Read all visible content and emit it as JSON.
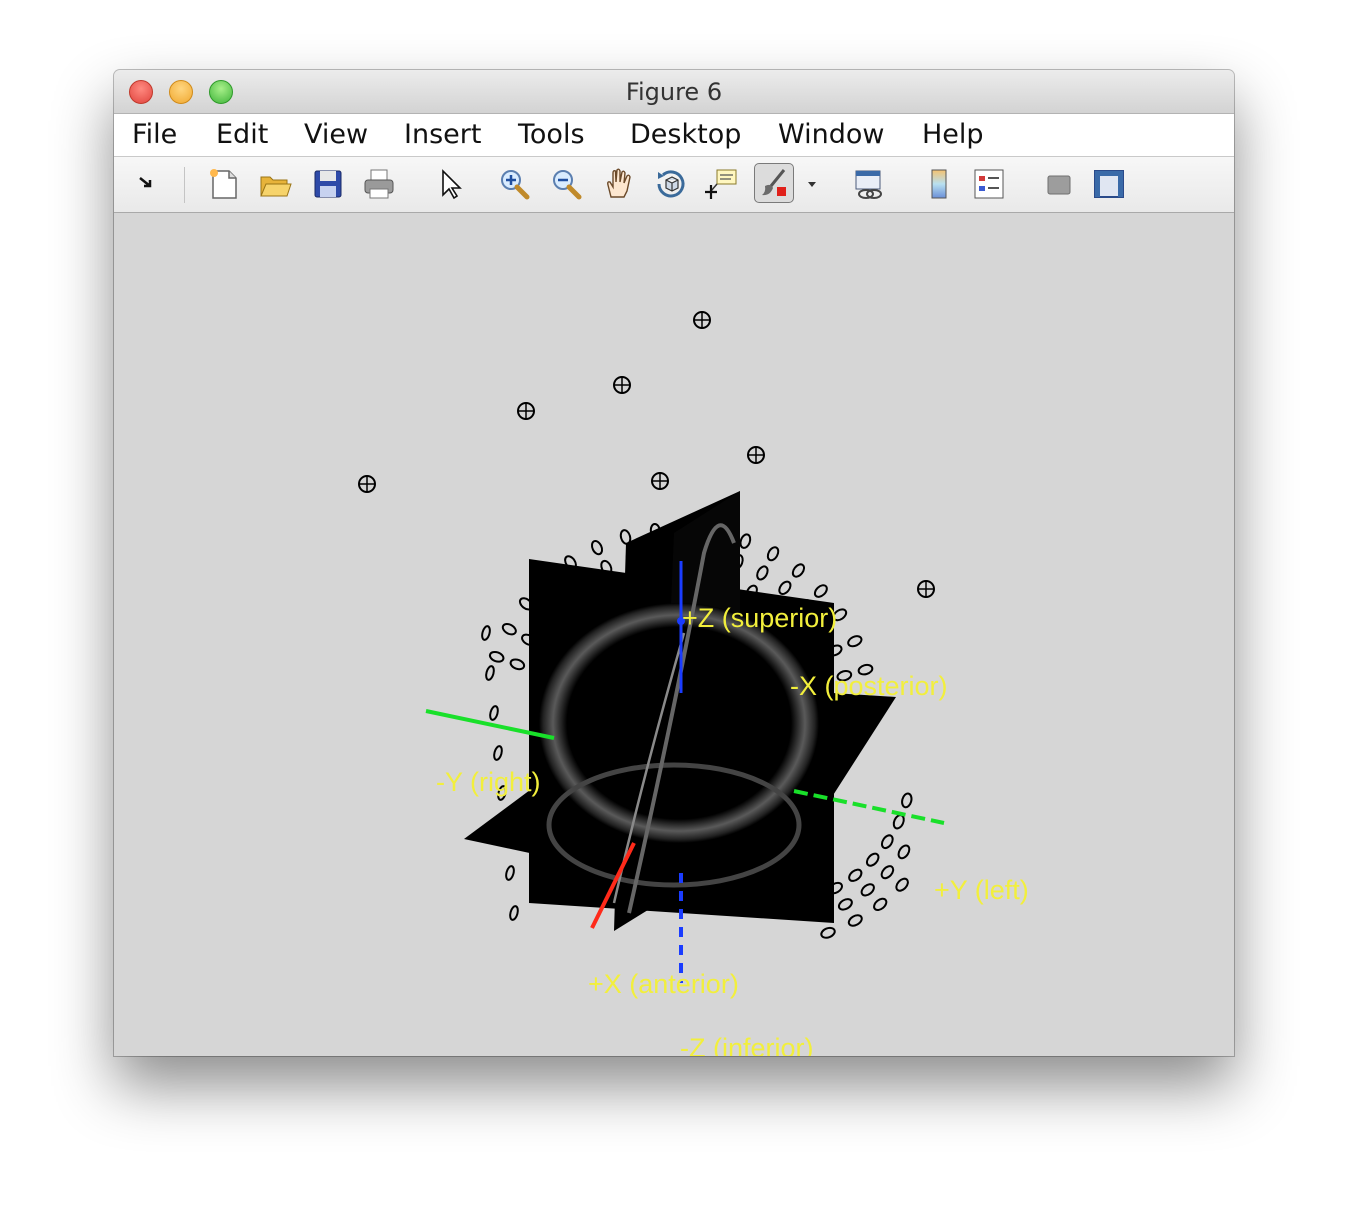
{
  "window": {
    "title": "Figure 6"
  },
  "menu": {
    "items": [
      "File",
      "Edit",
      "View",
      "Insert",
      "Tools",
      "Desktop",
      "Window",
      "Help"
    ]
  },
  "toolbar": {
    "buttons": [
      "dock-icon",
      "new-figure-icon",
      "open-file-icon",
      "save-icon",
      "print-icon",
      "edit-plot-arrow-icon",
      "zoom-in-icon",
      "zoom-out-icon",
      "pan-hand-icon",
      "rotate-3d-icon",
      "data-cursor-icon",
      "brush-icon",
      "brush-dropdown-icon",
      "link-plot-icon",
      "colorbar-icon",
      "legend-icon",
      "hide-plot-tools-icon",
      "show-plot-tools-icon"
    ],
    "active": "brush-icon"
  },
  "plot": {
    "labels": {
      "z_superior": "+Z (superior)",
      "x_posterior": "-X (posterior)",
      "y_right": "-Y (right)",
      "y_left": "+Y (left)",
      "x_anterior": "+X (anterior)",
      "z_inferior": "-Z (inferior)"
    },
    "colors": {
      "x_axis": "#ff2a1a",
      "y_axis": "#19e02a",
      "z_axis": "#1a3cff",
      "label": "#f2ef3c",
      "slice": "#000000",
      "background": "#d6d6d6"
    }
  }
}
